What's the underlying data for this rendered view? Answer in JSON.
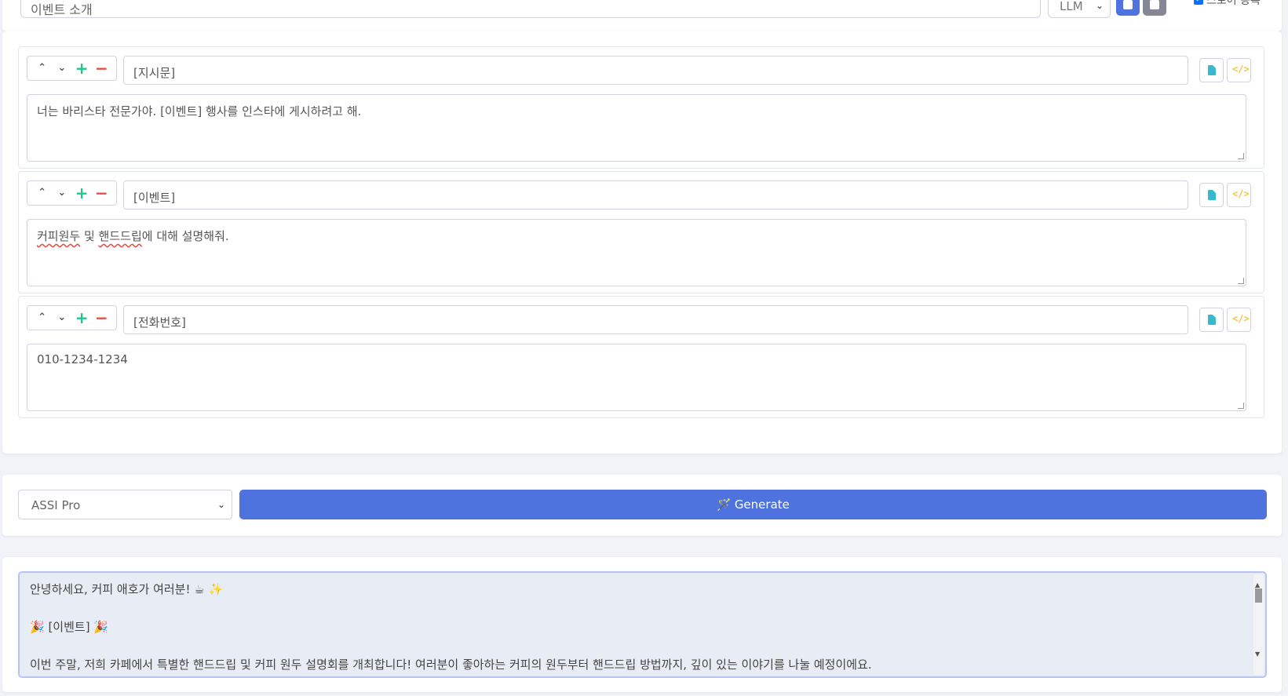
{
  "header": {
    "title_value": "이벤트 소개",
    "llm_select": "LLM",
    "store_label": "스토어 등록"
  },
  "blocks": [
    {
      "label": "[지시문]",
      "content": "너는 바리스타 전문가야. [이벤트] 행사를 인스타에 게시하려고 해."
    },
    {
      "label": "[이벤트]",
      "content_parts": [
        "커피원두",
        " 및 ",
        "핸드드립",
        "에 대해 설명해줘."
      ]
    },
    {
      "label": "[전화번호]",
      "content": "010-1234-1234"
    }
  ],
  "controls": {
    "up": "⌃",
    "down": "⌄",
    "plus": "+",
    "minus": "−",
    "code": "</>"
  },
  "generate": {
    "model": "ASSI Pro",
    "button_label": "Generate"
  },
  "output": {
    "lines": [
      "안녕하세요, 커피 애호가 여러분! ☕ ✨",
      "🎉 [이벤트] 🎉",
      "이번 주말, 저희 카페에서 특별한 핸드드립 및 커피 원두 설명회를 개최합니다! 여러분이 좋아하는 커피의 원두부터 핸드드립 방법까지, 깊이 있는 이야기를 나눌 예정이에요."
    ]
  },
  "colors": {
    "primary": "#4e73df",
    "secondary": "#858796",
    "success": "#1cc88a",
    "danger": "#e74a3b",
    "info": "#36b9cc",
    "warning": "#f6c23e"
  }
}
